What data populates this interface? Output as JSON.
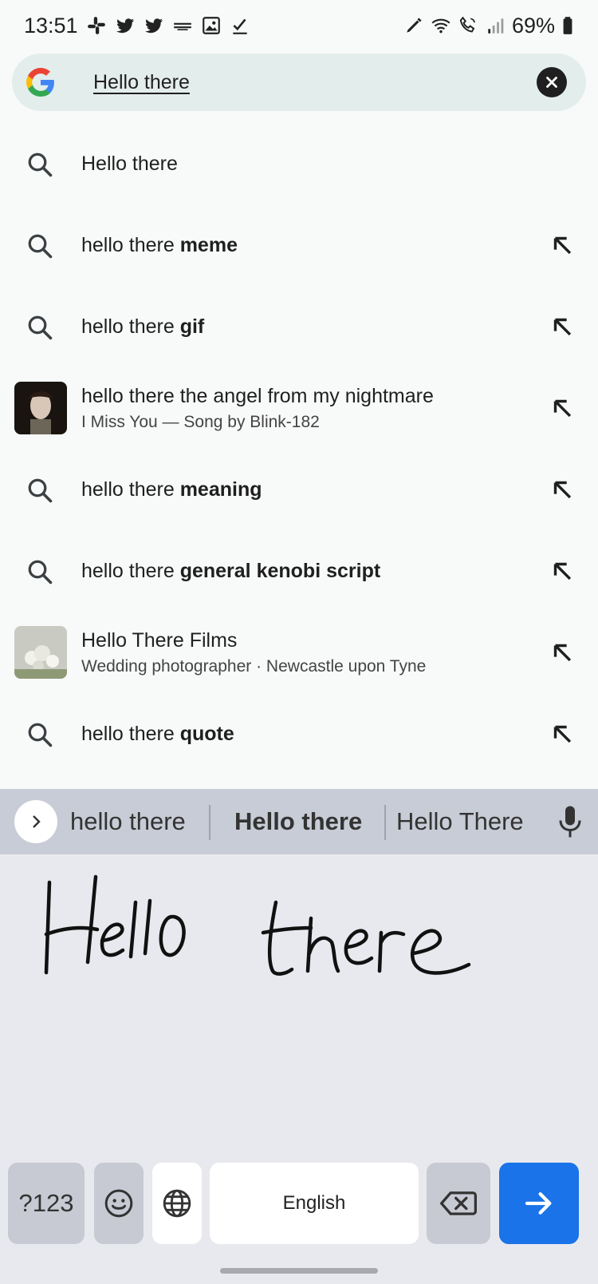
{
  "status_bar": {
    "time": "13:51",
    "battery": "69%",
    "left_icons": [
      "slack-icon",
      "twitter-icon",
      "twitter-icon",
      "keyboard-icon",
      "image-icon",
      "check-icon"
    ],
    "right_icons": [
      "edit-icon",
      "wifi-icon",
      "wifi-calling-icon",
      "signal-icon",
      "battery-icon"
    ]
  },
  "search": {
    "query": "Hello there",
    "clear_icon": "close-icon",
    "logo": "google-logo"
  },
  "suggestions": [
    {
      "type": "search",
      "prefix": "Hello there",
      "bold": "",
      "subtitle": "",
      "has_arrow": false
    },
    {
      "type": "search",
      "prefix": "hello there ",
      "bold": "meme",
      "subtitle": "",
      "has_arrow": true
    },
    {
      "type": "search",
      "prefix": "hello there ",
      "bold": "gif",
      "subtitle": "",
      "has_arrow": true
    },
    {
      "type": "thumbnail",
      "prefix": "hello there the angel from my nightmare",
      "bold": "",
      "subtitle": "I Miss You — Song by Blink-182",
      "has_arrow": true
    },
    {
      "type": "search",
      "prefix": "hello there ",
      "bold": "meaning",
      "subtitle": "",
      "has_arrow": true
    },
    {
      "type": "search",
      "prefix": "hello there ",
      "bold": "general kenobi script",
      "subtitle": "",
      "has_arrow": true
    },
    {
      "type": "thumbnail",
      "prefix": "Hello There Films",
      "bold": "",
      "subtitle": "Wedding photographer · Newcastle upon Tyne",
      "has_arrow": true
    },
    {
      "type": "search",
      "prefix": "hello there ",
      "bold": "quote",
      "subtitle": "",
      "has_arrow": true
    }
  ],
  "keyboard": {
    "candidates": [
      "hello there",
      "Hello there",
      "Hello There"
    ],
    "selected_candidate": "Hello there",
    "handwriting_text": "Hello there",
    "keys": {
      "symbols": "?123",
      "emoji": "emoji-icon",
      "language": "globe-icon",
      "space": "English",
      "backspace": "backspace-icon",
      "enter": "arrow-right-icon"
    },
    "accent_color": "#1a73e8"
  }
}
